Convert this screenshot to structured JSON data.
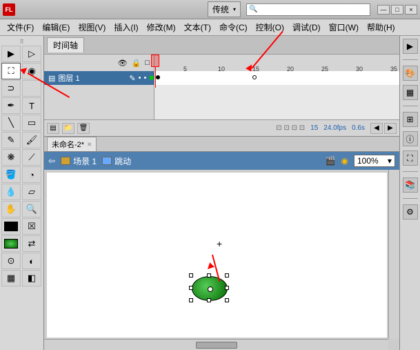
{
  "title_logo": "FL",
  "layout_label": "传统",
  "search_placeholder": "",
  "window_buttons": {
    "min": "—",
    "max": "□",
    "close": "×"
  },
  "menu": [
    "文件(F)",
    "编辑(E)",
    "视图(V)",
    "插入(I)",
    "修改(M)",
    "文本(T)",
    "命令(C)",
    "控制(O)",
    "调试(D)",
    "窗口(W)",
    "帮助(H)"
  ],
  "timeline": {
    "tab": "时间轴",
    "ruler": [
      "5",
      "10",
      "15",
      "20",
      "25",
      "30",
      "35"
    ],
    "layer_name": "图层 1",
    "footer": {
      "frame": "15",
      "fps": "24.0fps",
      "time": "0.6s"
    }
  },
  "document": {
    "tab": "未命名-2*"
  },
  "breadcrumb": {
    "scene": "场景 1",
    "symbol": "跳动",
    "zoom": "100%"
  },
  "icons": {
    "eye": "👁",
    "lock": "🔒",
    "outline": "□",
    "page": "▤",
    "folder": "📁",
    "trash": "🗑",
    "pencil": "✎",
    "dot": "•",
    "square": "■",
    "arrow_l": "◀",
    "arrow_r": "▶",
    "dd": "▾"
  }
}
